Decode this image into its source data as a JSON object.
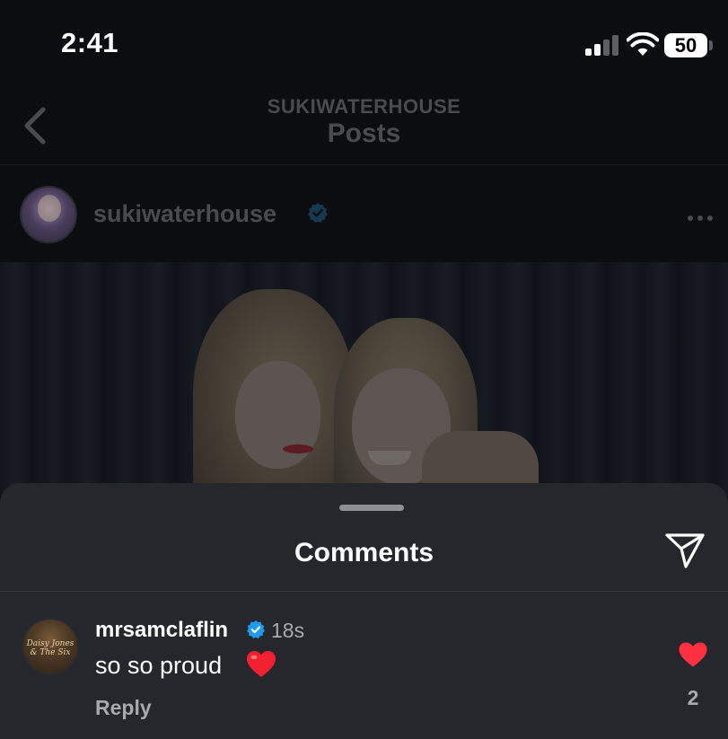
{
  "status_bar": {
    "time": "2:41",
    "battery": "50"
  },
  "header": {
    "subtitle": "SUKIWATERHOUSE",
    "title": "Posts",
    "back_icon": "chevron-left-icon"
  },
  "post": {
    "username": "sukiwaterhouse",
    "verified_icon": "verified-badge-icon",
    "more_icon": "more-horizontal-icon"
  },
  "comments_sheet": {
    "title": "Comments",
    "share_icon": "send-icon",
    "comments": [
      {
        "username": "mrsamclaflin",
        "avatar_text": "Daisy Jones & The Six",
        "time": "18s",
        "text": "so so proud",
        "emoji": "red-heart-emoji",
        "reply_label": "Reply",
        "likes": "2",
        "liked": true
      }
    ]
  },
  "colors": {
    "background": "#0c0d10",
    "sheet": "#25272c",
    "verified": "#1d9bf0",
    "like": "#ff3040"
  }
}
